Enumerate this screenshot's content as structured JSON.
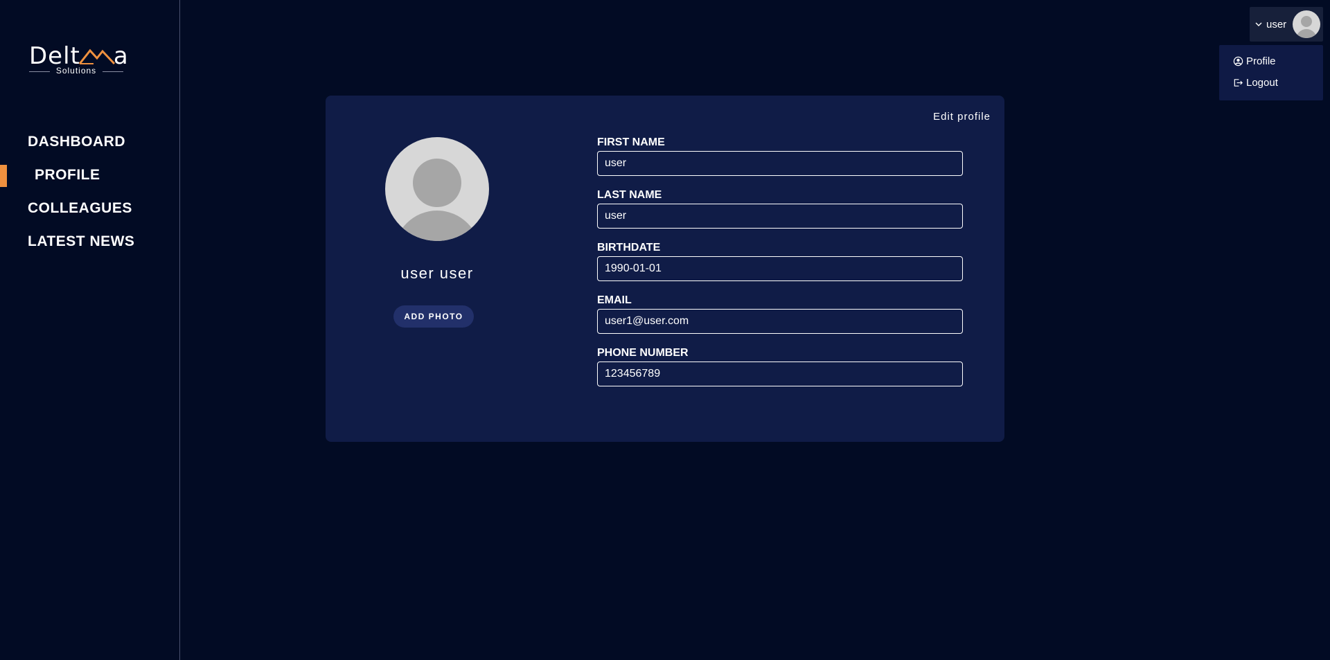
{
  "logo": {
    "word_left": "Delt",
    "word_right": "a",
    "sub": "Solutions",
    "accent": "#f0913f"
  },
  "nav": {
    "items": [
      {
        "label": "DASHBOARD",
        "active": false
      },
      {
        "label": "PROFILE",
        "active": true
      },
      {
        "label": "COLLEAGUES",
        "active": false
      },
      {
        "label": "LATEST NEWS",
        "active": false
      }
    ]
  },
  "user_menu": {
    "name": "user",
    "icon": "chevron-down-icon",
    "dropdown": {
      "profile_label": "Profile",
      "profile_icon": "user-circle-icon",
      "logout_label": "Logout",
      "logout_icon": "logout-icon"
    }
  },
  "profile": {
    "edit_label": "Edit profile",
    "display_name": "user user",
    "add_photo_label": "ADD PHOTO",
    "fields": [
      {
        "label": "FIRST NAME",
        "value": "user"
      },
      {
        "label": "LAST NAME",
        "value": "user"
      },
      {
        "label": "BIRTHDATE",
        "value": "1990-01-01"
      },
      {
        "label": "EMAIL",
        "value": "user1@user.com"
      },
      {
        "label": "PHONE NUMBER",
        "value": "123456789"
      }
    ]
  },
  "colors": {
    "background": "#020b24",
    "card": "#101c47",
    "accent": "#f0913f",
    "button": "#22306a"
  }
}
